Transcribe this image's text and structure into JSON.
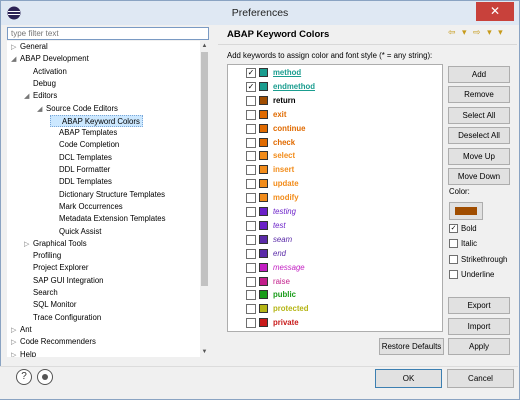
{
  "window": {
    "title": "Preferences",
    "close_glyph": "✕"
  },
  "filter": {
    "placeholder": "type filter text"
  },
  "tree": [
    {
      "label": "General",
      "twisty": "▷"
    },
    {
      "label": "ABAP Development",
      "twisty": "◢"
    },
    {
      "label": "Activation",
      "twisty": ""
    },
    {
      "label": "Debug",
      "twisty": ""
    },
    {
      "label": "Editors",
      "twisty": "◢"
    },
    {
      "label": "Source Code Editors",
      "twisty": "◢"
    },
    {
      "label": "ABAP Keyword Colors",
      "twisty": ""
    },
    {
      "label": "ABAP Templates",
      "twisty": ""
    },
    {
      "label": "Code Completion",
      "twisty": ""
    },
    {
      "label": "DCL Templates",
      "twisty": ""
    },
    {
      "label": "DDL Formatter",
      "twisty": ""
    },
    {
      "label": "DDL Templates",
      "twisty": ""
    },
    {
      "label": "Dictionary Structure Templates",
      "twisty": ""
    },
    {
      "label": "Mark Occurrences",
      "twisty": ""
    },
    {
      "label": "Metadata Extension Templates",
      "twisty": ""
    },
    {
      "label": "Quick Assist",
      "twisty": ""
    },
    {
      "label": "Graphical Tools",
      "twisty": "▷"
    },
    {
      "label": "Profiling",
      "twisty": ""
    },
    {
      "label": "Project Explorer",
      "twisty": ""
    },
    {
      "label": "SAP GUI Integration",
      "twisty": ""
    },
    {
      "label": "Search",
      "twisty": ""
    },
    {
      "label": "SQL Monitor",
      "twisty": ""
    },
    {
      "label": "Trace Configuration",
      "twisty": ""
    },
    {
      "label": "Ant",
      "twisty": "▷"
    },
    {
      "label": "Code Recommenders",
      "twisty": "▷"
    },
    {
      "label": "Help",
      "twisty": "▷"
    }
  ],
  "pane": {
    "title": "ABAP Keyword Colors",
    "description": "Add keywords to assign color and font style (* = any string):"
  },
  "keywords": [
    {
      "label": "method",
      "checked": "✓",
      "color": "#1a9d8f",
      "style": "bold-underline"
    },
    {
      "label": "endmethod",
      "checked": "✓",
      "color": "#1a9d8f",
      "style": "bold-underline"
    },
    {
      "label": "return",
      "checked": "",
      "color": "#a04d00",
      "style": "bold"
    },
    {
      "label": "exit",
      "checked": "",
      "color": "#e06a00",
      "style": "bold"
    },
    {
      "label": "continue",
      "checked": "",
      "color": "#e06a00",
      "style": "bold"
    },
    {
      "label": "check",
      "checked": "",
      "color": "#e06a00",
      "style": "bold"
    },
    {
      "label": "select",
      "checked": "",
      "color": "#f28c1a",
      "style": "bold"
    },
    {
      "label": "insert",
      "checked": "",
      "color": "#f28c1a",
      "style": "bold"
    },
    {
      "label": "update",
      "checked": "",
      "color": "#f28c1a",
      "style": "bold"
    },
    {
      "label": "modify",
      "checked": "",
      "color": "#f28c1a",
      "style": "bold"
    },
    {
      "label": "testing",
      "checked": "",
      "color": "#6a1fc8",
      "style": "italic"
    },
    {
      "label": "test",
      "checked": "",
      "color": "#6a1fc8",
      "style": "italic"
    },
    {
      "label": "seam",
      "checked": "",
      "color": "#5a2aa8",
      "style": "italic"
    },
    {
      "label": "end",
      "checked": "",
      "color": "#5a2aa8",
      "style": "italic"
    },
    {
      "label": "message",
      "checked": "",
      "color": "#c21dc2",
      "style": "italic"
    },
    {
      "label": "raise",
      "checked": "",
      "color": "#c21d8a",
      "style": "normal"
    },
    {
      "label": "public",
      "checked": "",
      "color": "#1a9c1a",
      "style": "bold"
    },
    {
      "label": "protected",
      "checked": "",
      "color": "#b5b515",
      "style": "bold"
    },
    {
      "label": "private",
      "checked": "",
      "color": "#c81a1a",
      "style": "bold"
    }
  ],
  "buttons": {
    "add": "Add",
    "remove": "Remove",
    "select_all": "Select All",
    "deselect_all": "Deselect All",
    "move_up": "Move Up",
    "move_down": "Move Down",
    "export": "Export",
    "import": "Import",
    "restore": "Restore Defaults",
    "apply": "Apply",
    "ok": "OK",
    "cancel": "Cancel"
  },
  "color_label": "Color:",
  "selected_color": "#a04d00",
  "options": [
    {
      "label": "Bold",
      "checked": "✓"
    },
    {
      "label": "Italic",
      "checked": ""
    },
    {
      "label": "Strikethrough",
      "checked": ""
    },
    {
      "label": "Underline",
      "checked": ""
    }
  ],
  "icons": {
    "help": "?",
    "nav": "⇦ ▾ ⇨ ▾ ▾"
  }
}
